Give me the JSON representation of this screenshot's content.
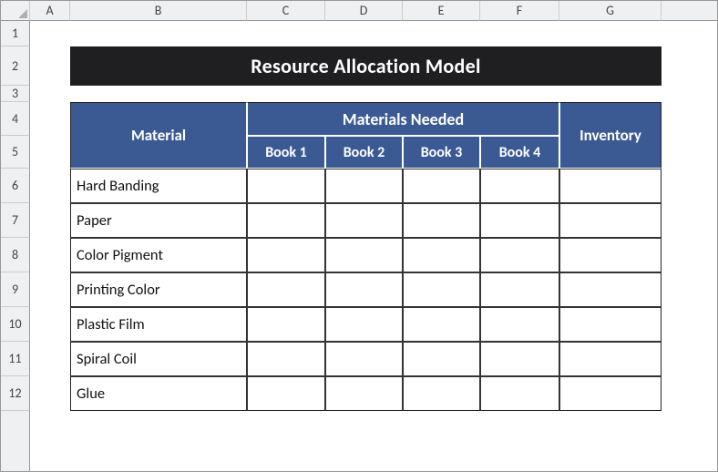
{
  "columns": [
    "A",
    "B",
    "C",
    "D",
    "E",
    "F",
    "G"
  ],
  "rows": [
    "1",
    "2",
    "3",
    "4",
    "5",
    "6",
    "7",
    "8",
    "9",
    "10",
    "11",
    "12"
  ],
  "title": "Resource Allocation Model",
  "headers": {
    "material": "Material",
    "materials_needed": "Materials Needed",
    "inventory": "Inventory",
    "books": [
      "Book 1",
      "Book 2",
      "Book 3",
      "Book 4"
    ]
  },
  "materials": [
    "Hard Banding",
    "Paper",
    "Color Pigment",
    "Printing Color",
    "Plastic Film",
    "Spiral Coil",
    "Glue"
  ],
  "chart_data": {
    "type": "table",
    "title": "Resource Allocation Model",
    "row_labels": [
      "Hard Banding",
      "Paper",
      "Color Pigment",
      "Printing Color",
      "Plastic Film",
      "Spiral Coil",
      "Glue"
    ],
    "column_groups": {
      "Materials Needed": [
        "Book 1",
        "Book 2",
        "Book 3",
        "Book 4"
      ],
      "Inventory": [
        "Inventory"
      ]
    },
    "values": [
      [
        null,
        null,
        null,
        null,
        null
      ],
      [
        null,
        null,
        null,
        null,
        null
      ],
      [
        null,
        null,
        null,
        null,
        null
      ],
      [
        null,
        null,
        null,
        null,
        null
      ],
      [
        null,
        null,
        null,
        null,
        null
      ],
      [
        null,
        null,
        null,
        null,
        null
      ],
      [
        null,
        null,
        null,
        null,
        null
      ]
    ]
  }
}
